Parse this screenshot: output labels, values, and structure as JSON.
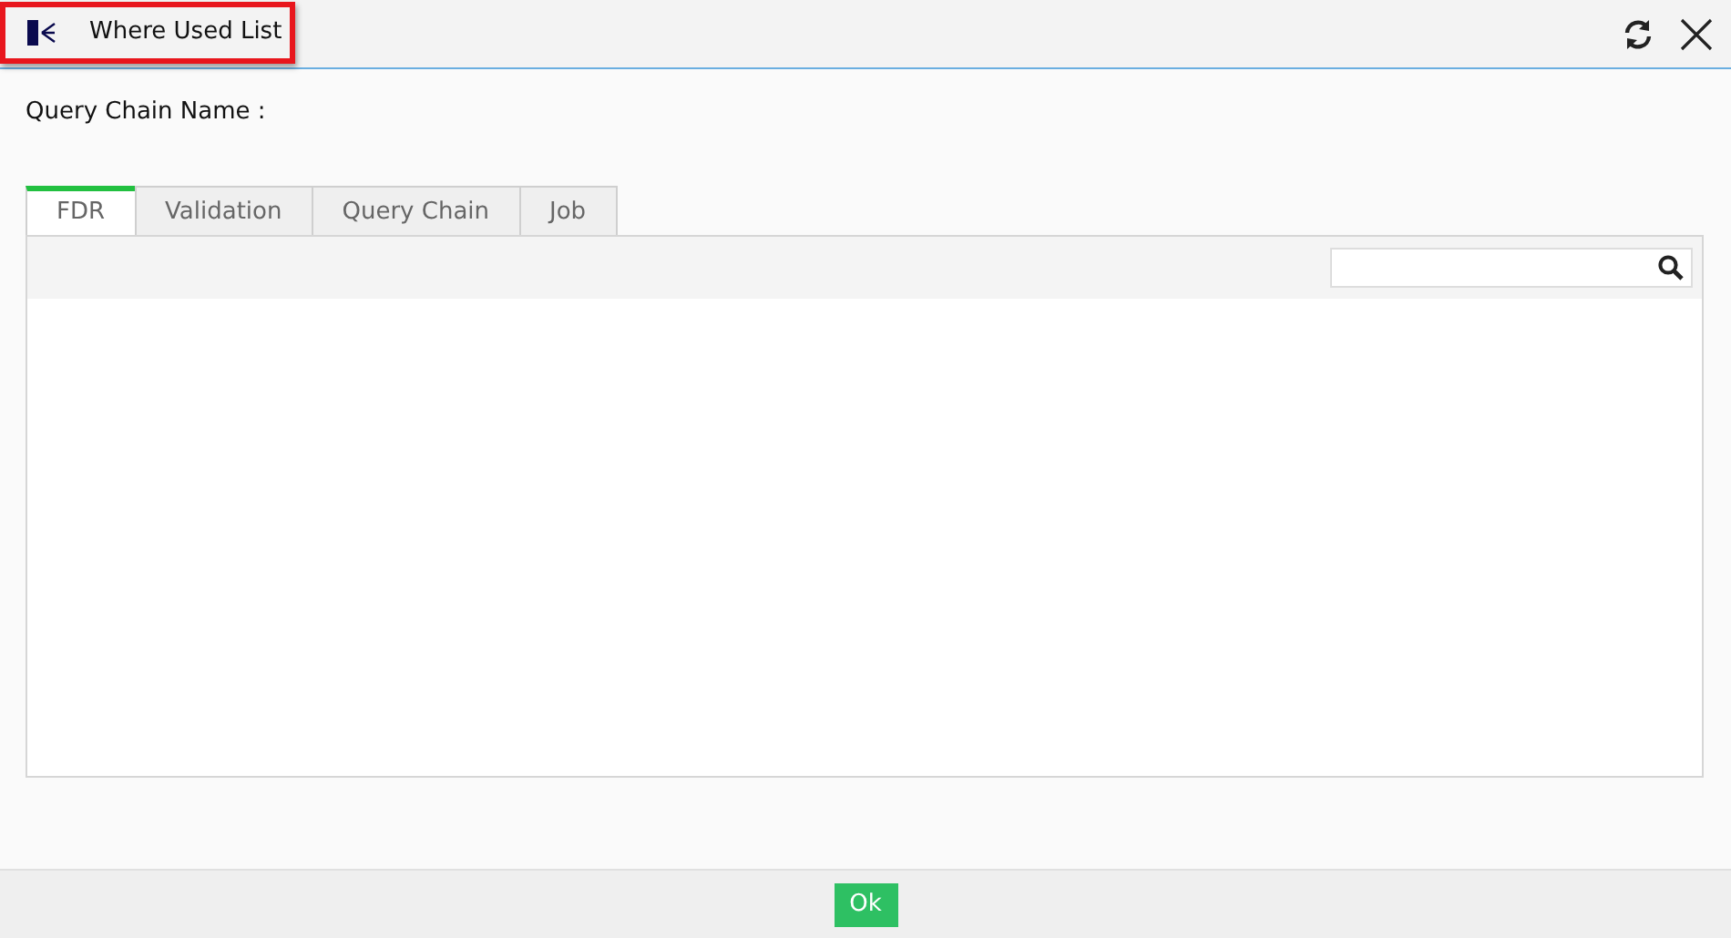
{
  "window": {
    "title": "Where Used List",
    "title_highlighted": true
  },
  "query_chain_name": {
    "label": "Query Chain Name :"
  },
  "tabs": [
    {
      "label": "FDR",
      "selected": true
    },
    {
      "label": "Validation",
      "selected": false
    },
    {
      "label": "Query Chain",
      "selected": false
    },
    {
      "label": "Job",
      "selected": false
    }
  ],
  "buttons": [
    "Ok"
  ]
}
